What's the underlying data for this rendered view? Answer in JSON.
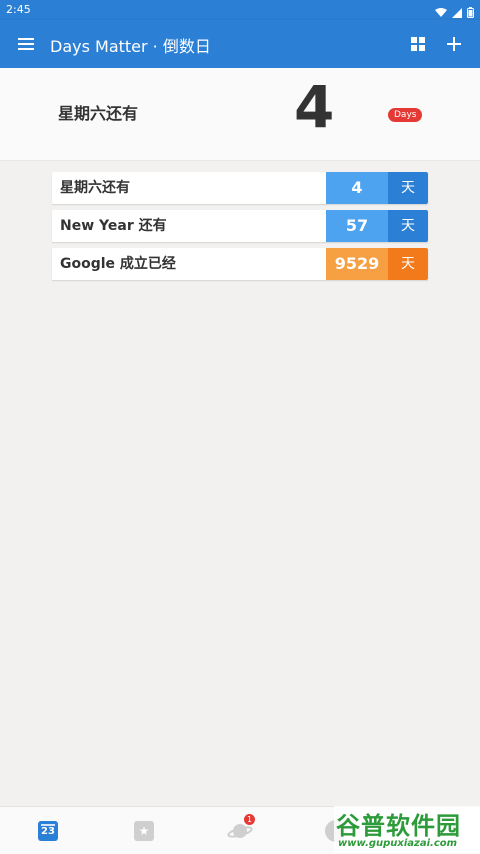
{
  "status_bar": {
    "time": "2:45"
  },
  "app_bar": {
    "title": "Days Matter · 倒数日"
  },
  "hero": {
    "label": "星期六还有",
    "number": "4",
    "badge": "Days"
  },
  "events": [
    {
      "name": "星期六还有",
      "days": "4",
      "unit": "天",
      "color": "#4da3f0"
    },
    {
      "name": "New Year 还有",
      "days": "57",
      "unit": "天",
      "color": "#4da3f0"
    },
    {
      "name": "Google 成立已经",
      "days": "9529",
      "unit": "天",
      "color": "#f7a043"
    }
  ],
  "bottom_nav": {
    "calendar_day": "23",
    "planet_badge": "1"
  },
  "watermark": {
    "text": "谷普软件园",
    "url": "www.gupuxiazai.com"
  },
  "colors": {
    "primary": "#2b7fd4",
    "accent_orange": "#f27a1a",
    "badge_red": "#e53935"
  }
}
